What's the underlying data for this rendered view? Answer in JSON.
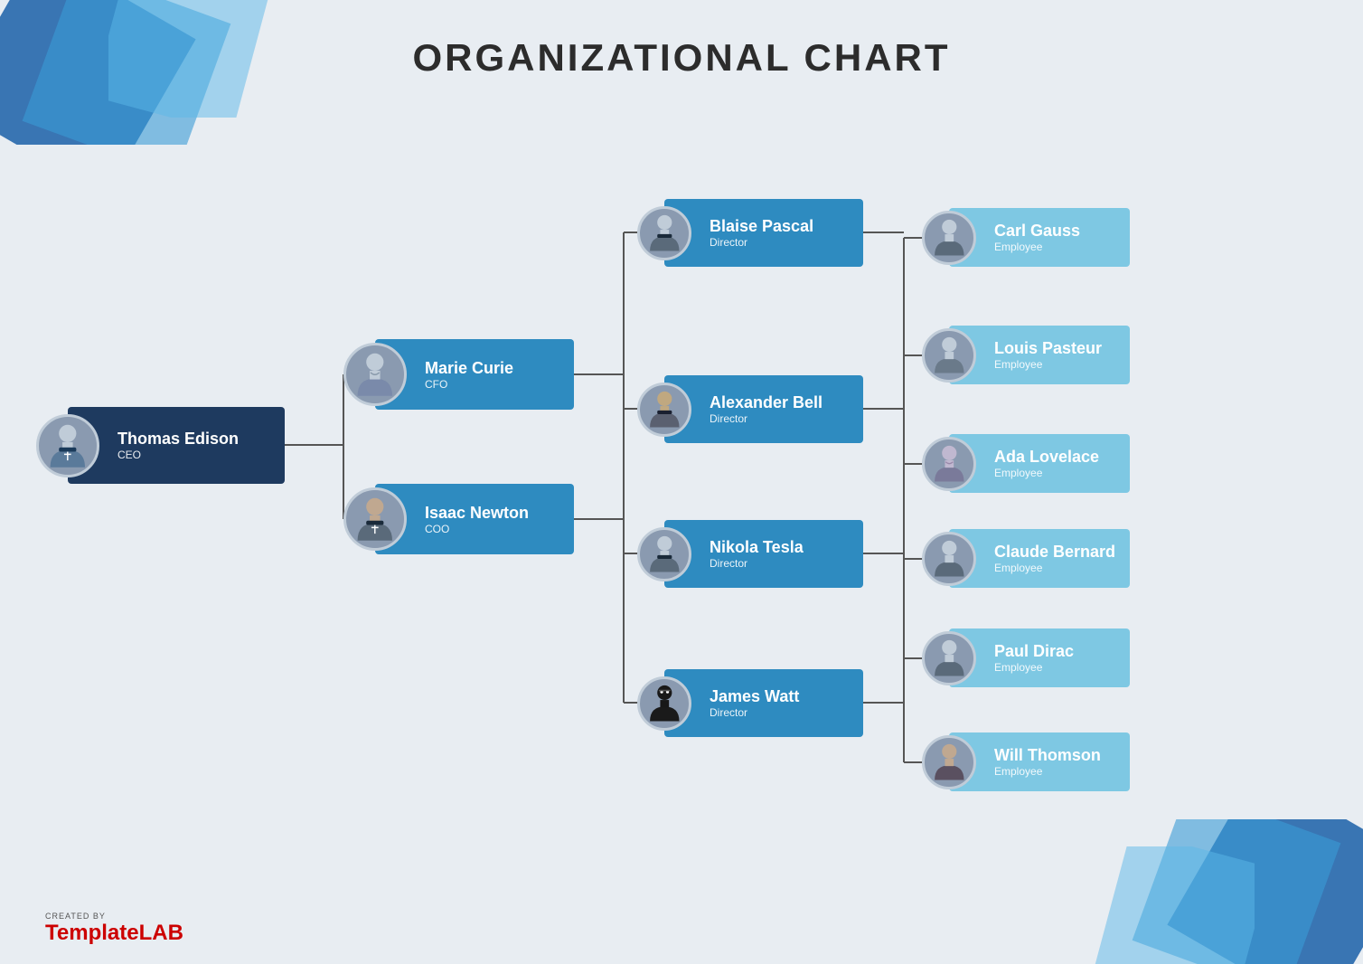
{
  "page": {
    "title": "ORGANIZATIONAL CHART",
    "background_color": "#e8edf2"
  },
  "logo": {
    "created_by": "CREATED BY",
    "brand_prefix": "Template",
    "brand_suffix": "LAB"
  },
  "nodes": {
    "ceo": {
      "name": "Thomas Edison",
      "title": "CEO",
      "style": "dark"
    },
    "cfo": {
      "name": "Marie Curie",
      "title": "CFO",
      "style": "blue"
    },
    "coo": {
      "name": "Isaac Newton",
      "title": "COO",
      "style": "blue"
    },
    "directors": [
      {
        "name": "Blaise Pascal",
        "title": "Director",
        "style": "blue"
      },
      {
        "name": "Alexander Bell",
        "title": "Director",
        "style": "blue"
      },
      {
        "name": "Nikola Tesla",
        "title": "Director",
        "style": "blue"
      },
      {
        "name": "James Watt",
        "title": "Director",
        "style": "blue"
      }
    ],
    "employees": [
      {
        "name": "Carl Gauss",
        "title": "Employee",
        "style": "light"
      },
      {
        "name": "Louis Pasteur",
        "title": "Employee",
        "style": "light"
      },
      {
        "name": "Ada Lovelace",
        "title": "Employee",
        "style": "light"
      },
      {
        "name": "Claude Bernard",
        "title": "Employee",
        "style": "light"
      },
      {
        "name": "Paul Dirac",
        "title": "Employee",
        "style": "light"
      },
      {
        "name": "Will Thomson",
        "title": "Employee",
        "style": "light"
      }
    ]
  },
  "colors": {
    "dark_blue": "#1e3a5f",
    "mid_blue": "#2e8bc0",
    "light_blue": "#7ec8e3",
    "avatar_bg": "#8a9ab0"
  }
}
